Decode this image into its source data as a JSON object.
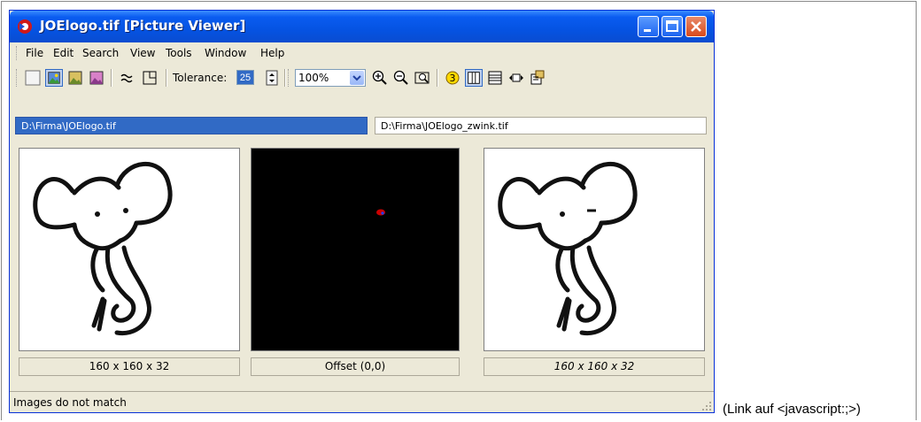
{
  "window": {
    "title": "JOElogo.tif [Picture Viewer]"
  },
  "menu": {
    "items": [
      "File",
      "Edit",
      "Search",
      "View",
      "Tools",
      "Window",
      "Help"
    ]
  },
  "toolbar": {
    "tolerance_label": "Tolerance:",
    "tolerance_value": "25",
    "zoom_value": "100%"
  },
  "paths": {
    "left": "D:\\Firma\\JOElogo.tif",
    "right": "D:\\Firma\\JOElogo_zwink.tif"
  },
  "captions": {
    "left": "160 x 160 x 32",
    "center": "Offset (0,0)",
    "right": "160 x 160 x 32"
  },
  "status": {
    "text": "Images do not match"
  },
  "external_link": "(Link auf <javascript:;>)",
  "colors": {
    "titlebar": "#0553e2",
    "selection": "#316ac5",
    "window_bg": "#ece9d8",
    "diff_marker": "#cc0000"
  }
}
